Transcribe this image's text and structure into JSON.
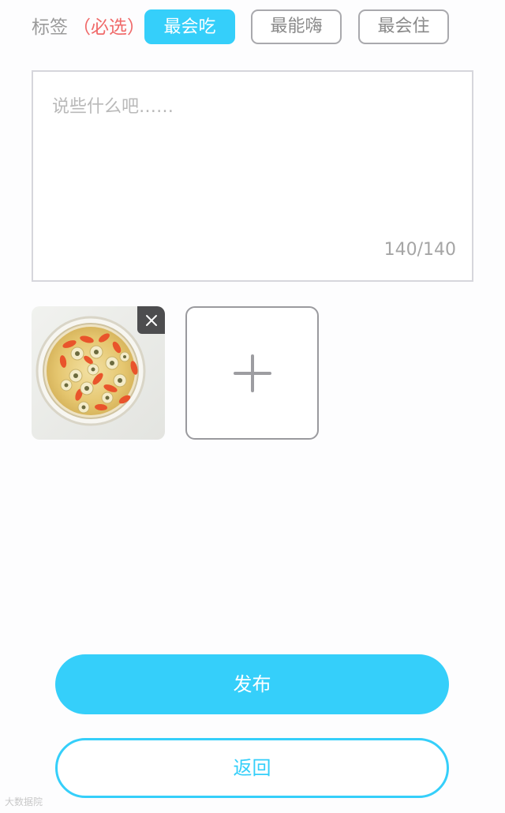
{
  "tags": {
    "label": "标签",
    "required_note": "（必选）",
    "options": [
      {
        "label": "最会吃",
        "selected": true
      },
      {
        "label": "最能嗨",
        "selected": false
      },
      {
        "label": "最会住",
        "selected": false
      }
    ]
  },
  "compose": {
    "placeholder": "说些什么吧……",
    "char_count": "140/140"
  },
  "photos": {
    "items": [
      {
        "icon": "food-photo-thumbnail",
        "remove_icon": "close-icon"
      }
    ],
    "add_icon": "plus-icon"
  },
  "actions": {
    "publish_label": "发布",
    "back_label": "返回"
  },
  "watermark": {
    "text": "大数据院"
  },
  "colors": {
    "accent": "#35cffa",
    "required": "#f06a6a",
    "border": "#d6d6dc"
  }
}
